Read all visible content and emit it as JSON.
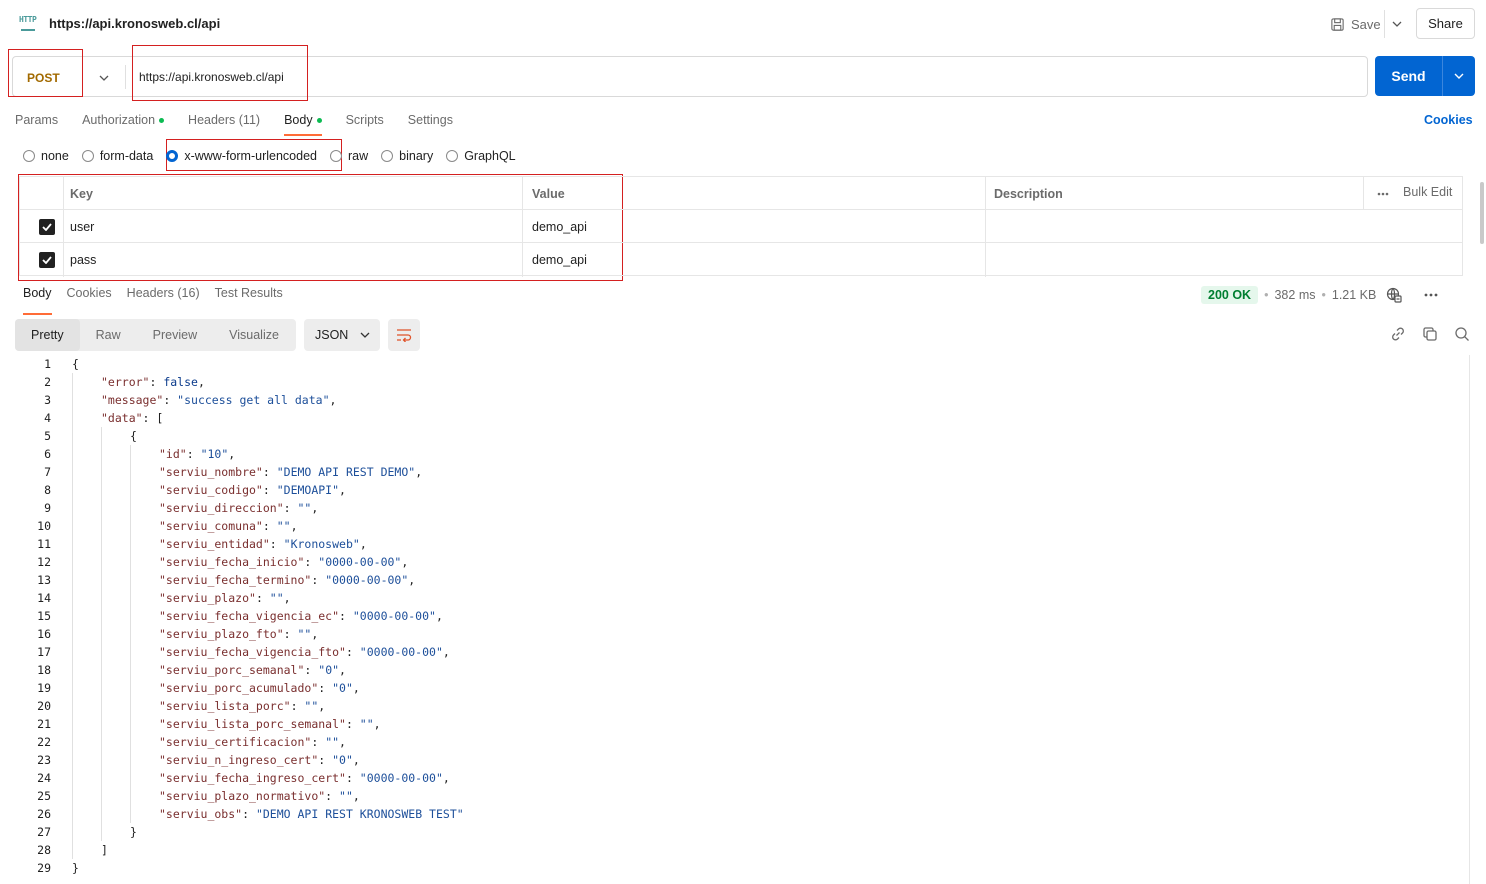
{
  "tab": {
    "title": "https://api.kronosweb.cl/api",
    "icon": "http-icon"
  },
  "header": {
    "save_label": "Save",
    "share_label": "Share"
  },
  "request": {
    "method": "POST",
    "url": "https://api.kronosweb.cl/api",
    "send_label": "Send",
    "tabs": [
      {
        "label": "Params",
        "dot": false
      },
      {
        "label": "Authorization",
        "dot": true
      },
      {
        "label": "Headers (11)",
        "dot": false
      },
      {
        "label": "Body",
        "dot": true
      },
      {
        "label": "Scripts",
        "dot": false
      },
      {
        "label": "Settings",
        "dot": false
      }
    ],
    "active_tab": "Body",
    "cookies_label": "Cookies",
    "body_types": [
      "none",
      "form-data",
      "x-www-form-urlencoded",
      "raw",
      "binary",
      "GraphQL"
    ],
    "selected_body_type": "x-www-form-urlencoded",
    "table": {
      "headers": {
        "key": "Key",
        "value": "Value",
        "description": "Description",
        "bulk_edit": "Bulk Edit"
      },
      "rows": [
        {
          "checked": true,
          "key": "user",
          "value": "demo_api",
          "description": ""
        },
        {
          "checked": true,
          "key": "pass",
          "value": "demo_api",
          "description": ""
        }
      ]
    }
  },
  "response": {
    "tabs": [
      "Body",
      "Cookies",
      "Headers (16)",
      "Test Results"
    ],
    "active_tab": "Body",
    "status": "200 OK",
    "time": "382 ms",
    "size": "1.21 KB",
    "views": [
      "Pretty",
      "Raw",
      "Preview",
      "Visualize"
    ],
    "active_view": "Pretty",
    "format": "JSON",
    "lines": [
      {
        "n": "1",
        "indent": 0,
        "parts": [
          [
            "p",
            "{"
          ]
        ]
      },
      {
        "n": "2",
        "indent": 1,
        "parts": [
          [
            "k",
            "\"error\""
          ],
          [
            "p",
            ": "
          ],
          [
            "b",
            "false"
          ],
          [
            "p",
            ","
          ]
        ]
      },
      {
        "n": "3",
        "indent": 1,
        "parts": [
          [
            "k",
            "\"message\""
          ],
          [
            "p",
            ": "
          ],
          [
            "s",
            "\"success get all data\""
          ],
          [
            "p",
            ","
          ]
        ]
      },
      {
        "n": "4",
        "indent": 1,
        "parts": [
          [
            "k",
            "\"data\""
          ],
          [
            "p",
            ": ["
          ]
        ]
      },
      {
        "n": "5",
        "indent": 2,
        "parts": [
          [
            "p",
            "{"
          ]
        ]
      },
      {
        "n": "6",
        "indent": 3,
        "parts": [
          [
            "k",
            "\"id\""
          ],
          [
            "p",
            ": "
          ],
          [
            "s",
            "\"10\""
          ],
          [
            "p",
            ","
          ]
        ]
      },
      {
        "n": "7",
        "indent": 3,
        "parts": [
          [
            "k",
            "\"serviu_nombre\""
          ],
          [
            "p",
            ": "
          ],
          [
            "s",
            "\"DEMO API REST DEMO\""
          ],
          [
            "p",
            ","
          ]
        ]
      },
      {
        "n": "8",
        "indent": 3,
        "parts": [
          [
            "k",
            "\"serviu_codigo\""
          ],
          [
            "p",
            ": "
          ],
          [
            "s",
            "\"DEMOAPI\""
          ],
          [
            "p",
            ","
          ]
        ]
      },
      {
        "n": "9",
        "indent": 3,
        "parts": [
          [
            "k",
            "\"serviu_direccion\""
          ],
          [
            "p",
            ": "
          ],
          [
            "s",
            "\"\""
          ],
          [
            "p",
            ","
          ]
        ]
      },
      {
        "n": "10",
        "indent": 3,
        "parts": [
          [
            "k",
            "\"serviu_comuna\""
          ],
          [
            "p",
            ": "
          ],
          [
            "s",
            "\"\""
          ],
          [
            "p",
            ","
          ]
        ]
      },
      {
        "n": "11",
        "indent": 3,
        "parts": [
          [
            "k",
            "\"serviu_entidad\""
          ],
          [
            "p",
            ": "
          ],
          [
            "s",
            "\"Kronosweb\""
          ],
          [
            "p",
            ","
          ]
        ]
      },
      {
        "n": "12",
        "indent": 3,
        "parts": [
          [
            "k",
            "\"serviu_fecha_inicio\""
          ],
          [
            "p",
            ": "
          ],
          [
            "s",
            "\"0000-00-00\""
          ],
          [
            "p",
            ","
          ]
        ]
      },
      {
        "n": "13",
        "indent": 3,
        "parts": [
          [
            "k",
            "\"serviu_fecha_termino\""
          ],
          [
            "p",
            ": "
          ],
          [
            "s",
            "\"0000-00-00\""
          ],
          [
            "p",
            ","
          ]
        ]
      },
      {
        "n": "14",
        "indent": 3,
        "parts": [
          [
            "k",
            "\"serviu_plazo\""
          ],
          [
            "p",
            ": "
          ],
          [
            "s",
            "\"\""
          ],
          [
            "p",
            ","
          ]
        ]
      },
      {
        "n": "15",
        "indent": 3,
        "parts": [
          [
            "k",
            "\"serviu_fecha_vigencia_ec\""
          ],
          [
            "p",
            ": "
          ],
          [
            "s",
            "\"0000-00-00\""
          ],
          [
            "p",
            ","
          ]
        ]
      },
      {
        "n": "16",
        "indent": 3,
        "parts": [
          [
            "k",
            "\"serviu_plazo_fto\""
          ],
          [
            "p",
            ": "
          ],
          [
            "s",
            "\"\""
          ],
          [
            "p",
            ","
          ]
        ]
      },
      {
        "n": "17",
        "indent": 3,
        "parts": [
          [
            "k",
            "\"serviu_fecha_vigencia_fto\""
          ],
          [
            "p",
            ": "
          ],
          [
            "s",
            "\"0000-00-00\""
          ],
          [
            "p",
            ","
          ]
        ]
      },
      {
        "n": "18",
        "indent": 3,
        "parts": [
          [
            "k",
            "\"serviu_porc_semanal\""
          ],
          [
            "p",
            ": "
          ],
          [
            "s",
            "\"0\""
          ],
          [
            "p",
            ","
          ]
        ]
      },
      {
        "n": "19",
        "indent": 3,
        "parts": [
          [
            "k",
            "\"serviu_porc_acumulado\""
          ],
          [
            "p",
            ": "
          ],
          [
            "s",
            "\"0\""
          ],
          [
            "p",
            ","
          ]
        ]
      },
      {
        "n": "20",
        "indent": 3,
        "parts": [
          [
            "k",
            "\"serviu_lista_porc\""
          ],
          [
            "p",
            ": "
          ],
          [
            "s",
            "\"\""
          ],
          [
            "p",
            ","
          ]
        ]
      },
      {
        "n": "21",
        "indent": 3,
        "parts": [
          [
            "k",
            "\"serviu_lista_porc_semanal\""
          ],
          [
            "p",
            ": "
          ],
          [
            "s",
            "\"\""
          ],
          [
            "p",
            ","
          ]
        ]
      },
      {
        "n": "22",
        "indent": 3,
        "parts": [
          [
            "k",
            "\"serviu_certificacion\""
          ],
          [
            "p",
            ": "
          ],
          [
            "s",
            "\"\""
          ],
          [
            "p",
            ","
          ]
        ]
      },
      {
        "n": "23",
        "indent": 3,
        "parts": [
          [
            "k",
            "\"serviu_n_ingreso_cert\""
          ],
          [
            "p",
            ": "
          ],
          [
            "s",
            "\"0\""
          ],
          [
            "p",
            ","
          ]
        ]
      },
      {
        "n": "24",
        "indent": 3,
        "parts": [
          [
            "k",
            "\"serviu_fecha_ingreso_cert\""
          ],
          [
            "p",
            ": "
          ],
          [
            "s",
            "\"0000-00-00\""
          ],
          [
            "p",
            ","
          ]
        ]
      },
      {
        "n": "25",
        "indent": 3,
        "parts": [
          [
            "k",
            "\"serviu_plazo_normativo\""
          ],
          [
            "p",
            ": "
          ],
          [
            "s",
            "\"\""
          ],
          [
            "p",
            ","
          ]
        ]
      },
      {
        "n": "26",
        "indent": 3,
        "parts": [
          [
            "k",
            "\"serviu_obs\""
          ],
          [
            "p",
            ": "
          ],
          [
            "s",
            "\"DEMO API REST KRONOSWEB TEST\""
          ]
        ]
      },
      {
        "n": "27",
        "indent": 2,
        "parts": [
          [
            "p",
            "}"
          ]
        ]
      },
      {
        "n": "28",
        "indent": 1,
        "parts": [
          [
            "p",
            "]"
          ]
        ]
      },
      {
        "n": "29",
        "indent": 0,
        "parts": [
          [
            "p",
            "}"
          ]
        ]
      }
    ]
  },
  "colors": {
    "accent": "#ff6c37",
    "send": "#0265d2",
    "method": "#a26a00",
    "status_ok": "#007f31",
    "highlight_box": "#d42020"
  }
}
